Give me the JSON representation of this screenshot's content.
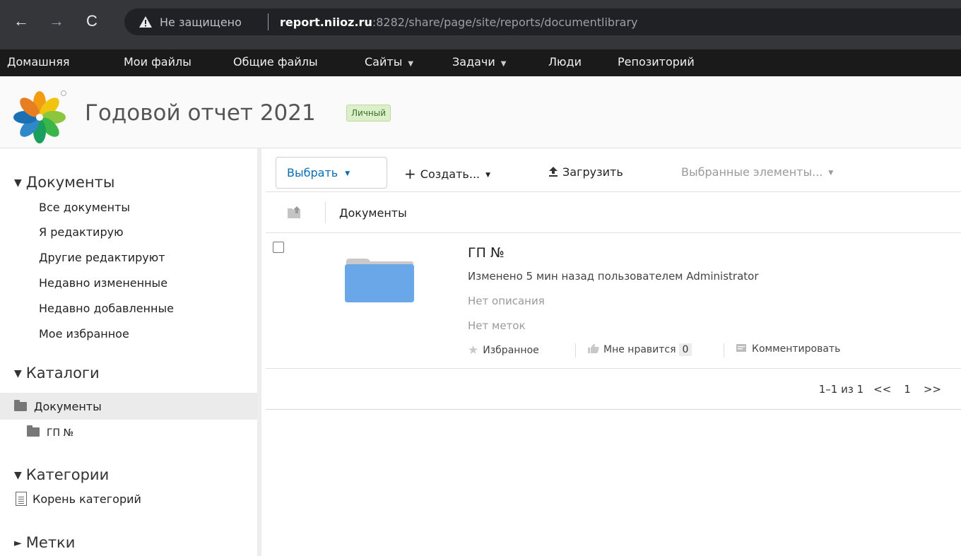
{
  "browser": {
    "insecure_label": "Не защищено",
    "url_host": "report.niioz.ru",
    "url_rest": ":8282/share/page/site/reports/documentlibrary",
    "back_icon": "arrow-back-icon",
    "forward_icon": "arrow-forward-icon",
    "reload_icon": "reload-icon"
  },
  "menu": {
    "home": "Домашняя",
    "my_files": "Мои файлы",
    "shared_files": "Общие файлы",
    "sites": "Сайты",
    "tasks": "Задачи",
    "people": "Люди",
    "repository": "Репозиторий"
  },
  "site": {
    "title": "Годовой отчет 2021",
    "visibility_badge": "Личный"
  },
  "sidebar": {
    "documents_header": "Документы",
    "doc_filters": [
      "Все документы",
      "Я редактирую",
      "Другие редактируют",
      "Недавно измененные",
      "Недавно добавленные",
      "Мое избранное"
    ],
    "catalogs_header": "Каталоги",
    "catalog_root": "Документы",
    "catalog_child": "ГП №",
    "categories_header": "Категории",
    "categories_root": "Корень категорий",
    "tags_header": "Метки"
  },
  "toolbar": {
    "select_label": "Выбрать",
    "create_label": "Создать...",
    "upload_label": "Загрузить",
    "selected_items_label": "Выбранные элементы..."
  },
  "breadcrumb": {
    "current": "Документы"
  },
  "items": [
    {
      "name": "ГП №",
      "modified": "Изменено 5 мин назад пользователем Administrator",
      "description": "Нет описания",
      "tags": "Нет меток",
      "favorite_label": "Избранное",
      "like_label": "Мне нравится",
      "like_count": "0",
      "comment_label": "Комментировать"
    }
  ],
  "pager": {
    "range": "1–1 из 1",
    "prev": "<<",
    "page": "1",
    "next": ">>"
  },
  "colors": {
    "menubar": "#1a1a1a",
    "link_blue": "#0b6bb3",
    "folder_blue": "#6aa7e8",
    "badge_green": "#dbefc8"
  }
}
